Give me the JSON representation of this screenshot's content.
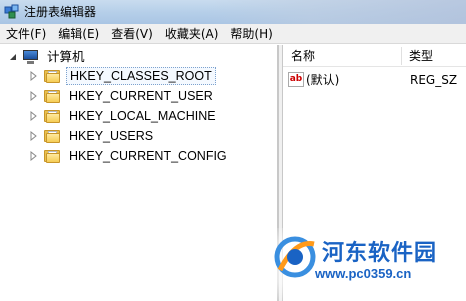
{
  "window": {
    "title": "注册表编辑器",
    "icon": "regedit-icon"
  },
  "menu": [
    {
      "label": "文件(F)"
    },
    {
      "label": "编辑(E)"
    },
    {
      "label": "查看(V)"
    },
    {
      "label": "收藏夹(A)"
    },
    {
      "label": "帮助(H)"
    }
  ],
  "tree": {
    "root": {
      "label": "计算机",
      "icon": "computer-icon",
      "expanded": true
    },
    "children": [
      {
        "label": "HKEY_CLASSES_ROOT",
        "selected": true
      },
      {
        "label": "HKEY_CURRENT_USER",
        "selected": false
      },
      {
        "label": "HKEY_LOCAL_MACHINE",
        "selected": false
      },
      {
        "label": "HKEY_USERS",
        "selected": false
      },
      {
        "label": "HKEY_CURRENT_CONFIG",
        "selected": false
      }
    ]
  },
  "list": {
    "columns": [
      {
        "label": "名称"
      },
      {
        "label": "类型"
      }
    ],
    "rows": [
      {
        "name": "(默认)",
        "type": "REG_SZ",
        "icon": "string-value-icon"
      }
    ]
  },
  "watermark": {
    "title": "河东软件园",
    "url": "www.pc0359.cn"
  },
  "colors": {
    "titlebar": "#b6cfe9",
    "menubar": "#f0f0f0",
    "folder": "#f5cc55",
    "watermark": "#1a63c4"
  }
}
